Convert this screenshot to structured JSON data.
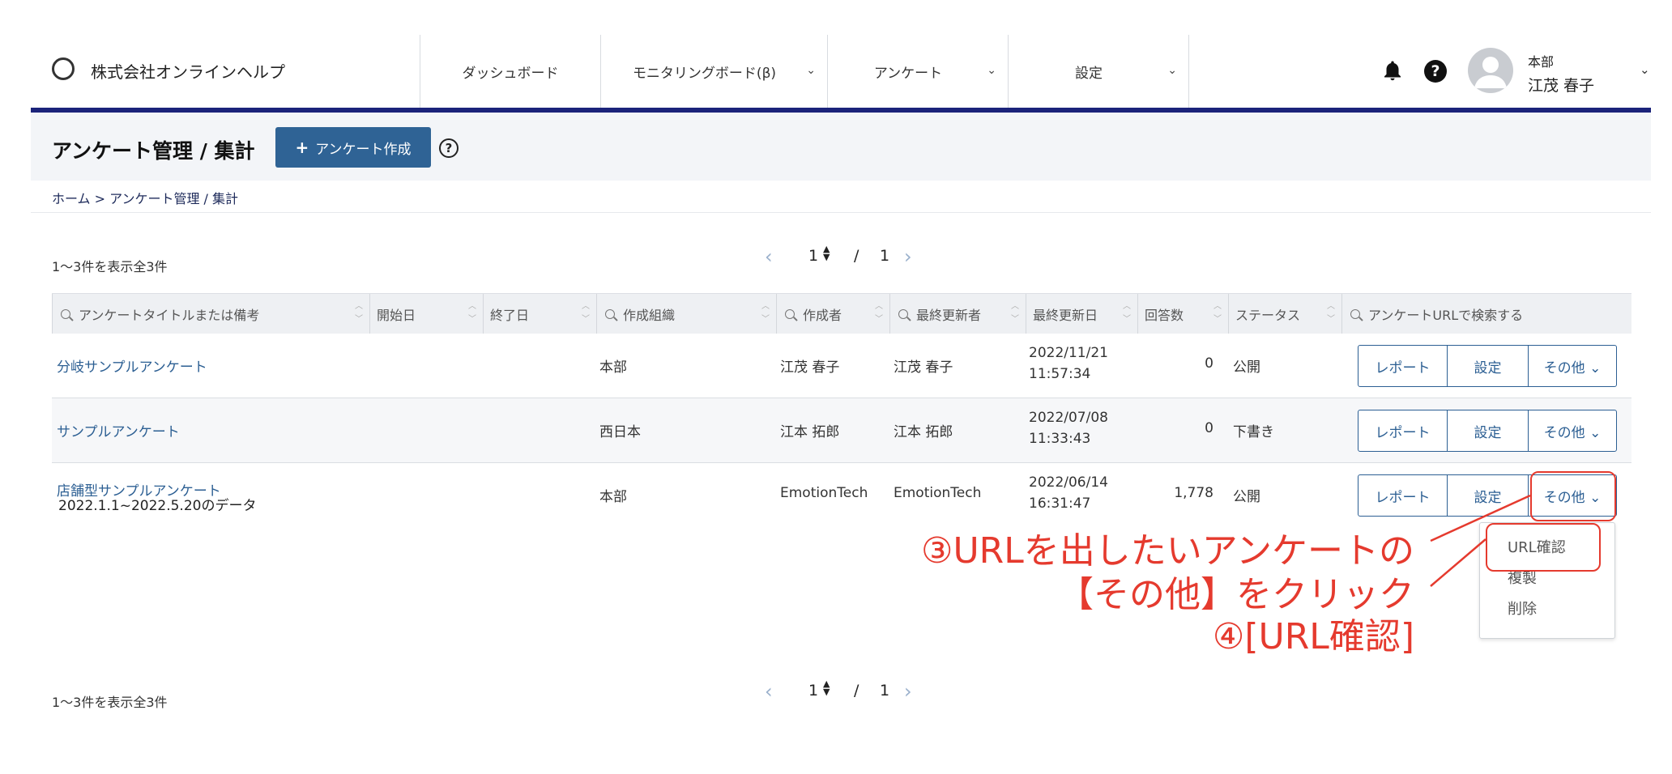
{
  "header": {
    "company": "株式会社オンラインヘルプ",
    "nav": [
      {
        "label": "ダッシュボード",
        "dropdown": false
      },
      {
        "label": "モニタリングボード(β)",
        "dropdown": true
      },
      {
        "label": "アンケート",
        "dropdown": true
      },
      {
        "label": "設定",
        "dropdown": true
      }
    ],
    "help_glyph": "?",
    "user": {
      "org": "本部",
      "name": "江茂 春子"
    },
    "chevron": "⌄"
  },
  "titlebar": {
    "title": "アンケート管理 / 集計",
    "create_label": "アンケート作成",
    "create_plus": "+",
    "help_glyph": "?"
  },
  "breadcrumb": "ホーム > アンケート管理 / 集計",
  "result_count": "1〜3件を表示全3件",
  "pagination": {
    "prev": "‹",
    "next": "›",
    "current": "1",
    "spin": "▲\n▼",
    "slash": "/",
    "total": "1"
  },
  "table": {
    "columns": [
      {
        "label": "アンケートタイトルまたは備考",
        "search": true
      },
      {
        "label": "開始日",
        "search": false
      },
      {
        "label": "終了日",
        "search": false
      },
      {
        "label": "作成組織",
        "search": true
      },
      {
        "label": "作成者",
        "search": true
      },
      {
        "label": "最終更新者",
        "search": true
      },
      {
        "label": "最終更新日",
        "search": false
      },
      {
        "label": "回答数",
        "search": false
      },
      {
        "label": "ステータス",
        "search": false
      },
      {
        "label": "アンケートURLで検索する",
        "search": true
      }
    ],
    "sort_glyph": "︿\n﹀",
    "rows": [
      {
        "title": "分岐サンプルアンケート",
        "note": "",
        "org": "本部",
        "creator": "江茂 春子",
        "updater": "江茂 春子",
        "updated_date": "2022/11/21",
        "updated_time": "11:57:34",
        "responses": "0",
        "status": "公開"
      },
      {
        "title": "サンプルアンケート",
        "note": "",
        "org": "西日本",
        "creator": "江本 拓郎",
        "updater": "江本 拓郎",
        "updated_date": "2022/07/08",
        "updated_time": "11:33:43",
        "responses": "0",
        "status": "下書き"
      },
      {
        "title": "店舗型サンプルアンケート",
        "note": "2022.1.1~2022.5.20のデータ",
        "org": "本部",
        "creator": "EmotionTech",
        "updater": "EmotionTech",
        "updated_date": "2022/06/14",
        "updated_time": "16:31:47",
        "responses": "1,778",
        "status": "公開"
      }
    ],
    "actions": {
      "report": "レポート",
      "settings": "設定",
      "other": "その他 ⌄"
    }
  },
  "dropdown_menu": [
    "URL確認",
    "複製",
    "削除"
  ],
  "annotations": {
    "line1": "③URLを出したいアンケートの",
    "line2": "【その他】をクリック",
    "line3": "④[URL確認]",
    "color": "#e53a2e"
  },
  "colors": {
    "primary": "#2f6395",
    "header_bar": "#1b237a",
    "link": "#2c5f93"
  }
}
